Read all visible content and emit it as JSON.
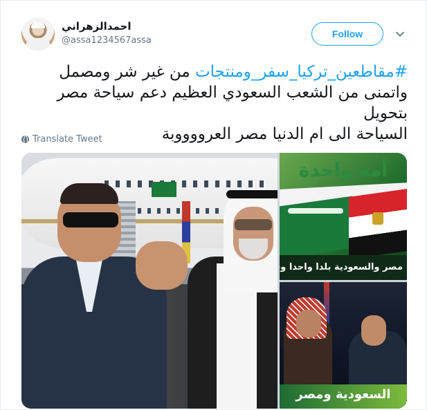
{
  "user": {
    "name": "احمدالزهراني",
    "handle": "@assa1234567assa"
  },
  "follow": {
    "label": "Follow"
  },
  "tweet": {
    "hashtag": "#مقاطعين_تركيا_سفر_ومنتجات",
    "line1_rest": " من غير شر ومصمل",
    "line2": "واتمنى من الشعب السعودي العظيم دعم سياحة مصر  بتحويل",
    "line3": "السياحة الى ام الدنيا مصر العرووووبة"
  },
  "translate": {
    "label": "Translate Tweet"
  },
  "media": {
    "top_right_heading": "أمة واحدة",
    "top_right_caption": "مصر والسعودية بلداً واحداً وشعباً",
    "bottom_right_banner": "السعودية ومصر"
  },
  "colors": {
    "accent": "#1da1f2",
    "text": "#14171a",
    "muted": "#657786"
  },
  "icons": {
    "caret": "chevron-down-icon",
    "translate": "globe-icon"
  }
}
